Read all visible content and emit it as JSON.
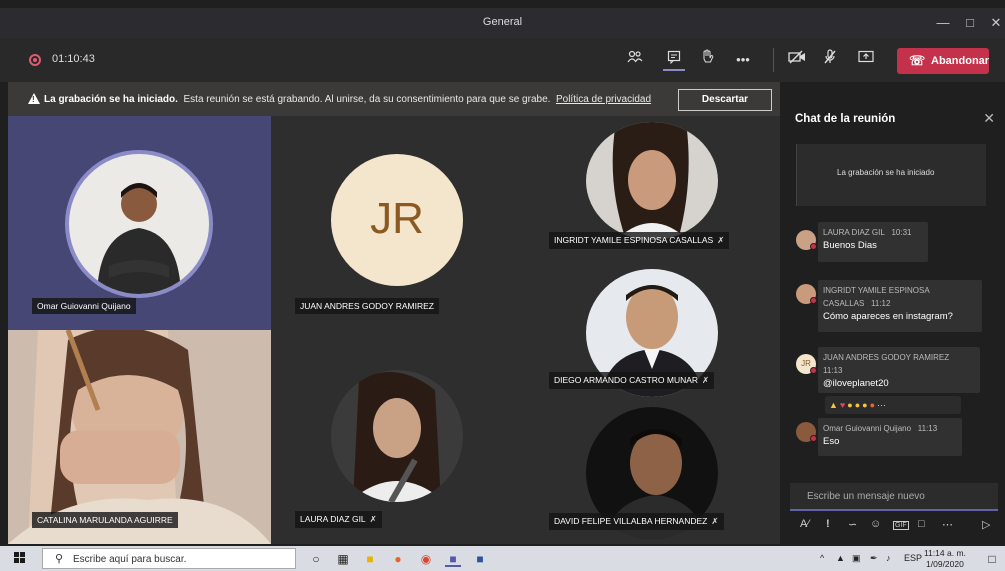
{
  "window": {
    "title": "General"
  },
  "toolbar": {
    "timer": "01:10:43",
    "leave_label": "Abandonar"
  },
  "banner": {
    "bold": "La grabación se ha iniciado.",
    "text": "Esta reunión se está grabando. Al unirse, da su consentimiento para que se grabe.",
    "link": "Política de privacidad",
    "dismiss": "Descartar"
  },
  "participants": [
    {
      "name": "Omar Guiovanni Quijano"
    },
    {
      "name": "JUAN ANDRES GODOY RAMIREZ",
      "initials": "JR"
    },
    {
      "name": "INGRIDT YAMILE ESPINOSA CASALLAS"
    },
    {
      "name": "DIEGO ARMANDO CASTRO MUNAR"
    },
    {
      "name": "CATALINA MARULANDA AGUIRRE"
    },
    {
      "name": "LAURA DIAZ GIL"
    },
    {
      "name": "DAVID FELIPE VILLALBA HERNANDEZ"
    }
  ],
  "chat": {
    "title": "Chat de la reunión",
    "system": "La grabación se ha iniciado",
    "messages": [
      {
        "who": "LAURA DIAZ GIL",
        "time": "10:31",
        "text": "Buenos Dias"
      },
      {
        "who": "INGRIDT YAMILE ESPINOSA",
        "who2": "CASALLAS",
        "time": "11:12",
        "text": "Cómo apareces en instagram?"
      },
      {
        "who": "JUAN ANDRES GODOY RAMIREZ",
        "time": "11:13",
        "text": "@iloveplanet20",
        "initials": "JR"
      },
      {
        "who": "Omar Guiovanni Quijano",
        "time": "11:13",
        "text": "Eso"
      }
    ],
    "compose_placeholder": "Escribe un mensaje nuevo"
  },
  "taskbar": {
    "search_placeholder": "Escribe aquí para buscar.",
    "lang": "ESP",
    "time": "11:14 a. m.",
    "date": "1/09/2020"
  },
  "colors": {
    "accent": "#6264a7",
    "leave": "#c4314b",
    "speaker_ring": "#8b8cc7"
  }
}
